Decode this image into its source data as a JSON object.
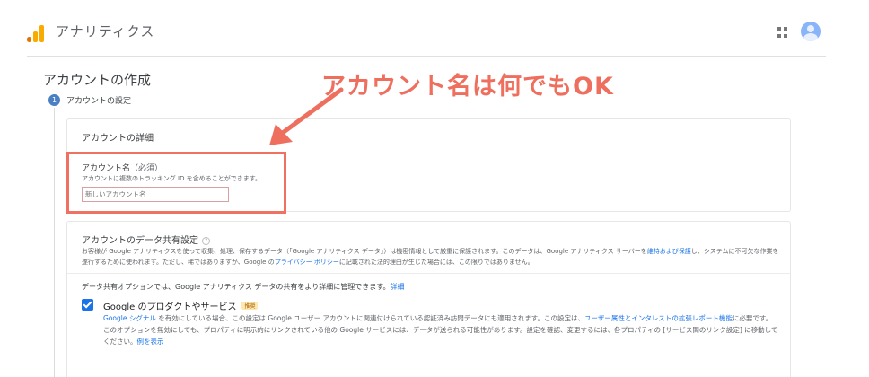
{
  "header": {
    "app_title": "アナリティクス",
    "apps_icon": "grid-apps-icon",
    "avatar_icon": "account-avatar-icon"
  },
  "page": {
    "title": "アカウントの作成",
    "step_number": "1",
    "step_label": "アカウントの設定"
  },
  "account_details": {
    "title": "アカウントの詳細",
    "field_label": "アカウント名",
    "field_required": "（必須）",
    "field_help": "アカウントに複数のトラッキング ID を含めることができます。",
    "field_value": "",
    "field_placeholder": "新しいアカウント名"
  },
  "data_sharing": {
    "title": "アカウントのデータ共有設定",
    "help_glyph": "?",
    "desc_part1": "お客様が Google アナリティクスを使って収集、処理、保存するデータ（「Google アナリティクス データ」）は機密情報として厳重に保護されます。このデータは、Google アナリティクス サーバーを",
    "desc_link1": "維持および保護",
    "desc_part2": "し、システムに不可欠な作業を遂行するために使われます。ただし、稀ではありますが、Google の",
    "desc_link2": "プライバシー ポリシー",
    "desc_part3": "に記載された法的理由が生じた場合には、この限りではありません。",
    "share_note": "データ共有オプションでは、Google アナリティクス データの共有をより詳細に管理できます。",
    "share_note_link": "詳細",
    "option": {
      "checked": true,
      "title": "Google のプロダクトやサービス",
      "badge": "推奨",
      "desc_link1": "Google シグナル",
      "desc_part1": " を有効にしている場合、この設定は Google ユーザー アカウントに関連付けられている認証済み訪問データにも適用されます。この設定は、",
      "desc_link2": "ユーザー属性とインタレストの拡張レポート機能",
      "desc_part2": "に必要です。このオプションを無効にしても、プロパティに明示的にリンクされている他の Google サービスには、データが送られる可能性があります。設定を確認、変更するには、各プロパティの [サービス間のリンク設定] に移動してください。",
      "desc_link3": "例を表示"
    }
  },
  "annotation": {
    "text": "アカウント名は何でもOK",
    "color": "#ef6f5f"
  }
}
